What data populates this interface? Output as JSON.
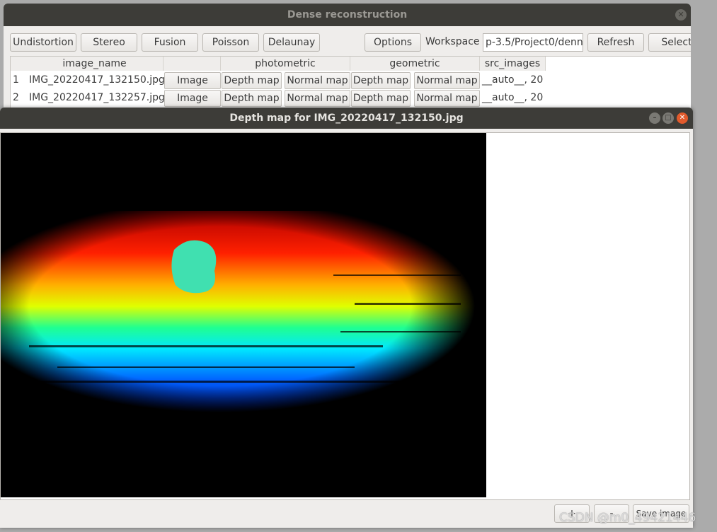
{
  "main_window": {
    "title": "Dense reconstruction",
    "toolbar": {
      "undistortion": "Undistortion",
      "stereo": "Stereo",
      "fusion": "Fusion",
      "poisson": "Poisson",
      "delaunay": "Delaunay",
      "options": "Options",
      "workspace_label": "Workspace",
      "workspace_value": "p-3.5/Project0/denn",
      "refresh": "Refresh",
      "select": "Select"
    },
    "table": {
      "headers": [
        "image_name",
        "",
        "photometric",
        "geometric",
        "src_images"
      ],
      "rows": [
        {
          "index": "1",
          "image_name": "IMG_20220417_132150.jpg",
          "image": "Image",
          "photo_depth": "Depth map",
          "photo_normal": "Normal map",
          "geo_depth": "Depth map",
          "geo_normal": "Normal map",
          "src_images": "__auto__, 20"
        },
        {
          "index": "2",
          "image_name": "IMG_20220417_132257.jpg",
          "image": "Image",
          "photo_depth": "Depth map",
          "photo_normal": "Normal map",
          "geo_depth": "Depth map",
          "geo_normal": "Normal map",
          "src_images": "__auto__, 20"
        }
      ]
    }
  },
  "depth_window": {
    "title": "Depth map for IMG_20220417_132150.jpg",
    "zoom_in": "+",
    "zoom_out": "-",
    "save": "Save image"
  },
  "watermark": "CSDN @m0_49421446"
}
